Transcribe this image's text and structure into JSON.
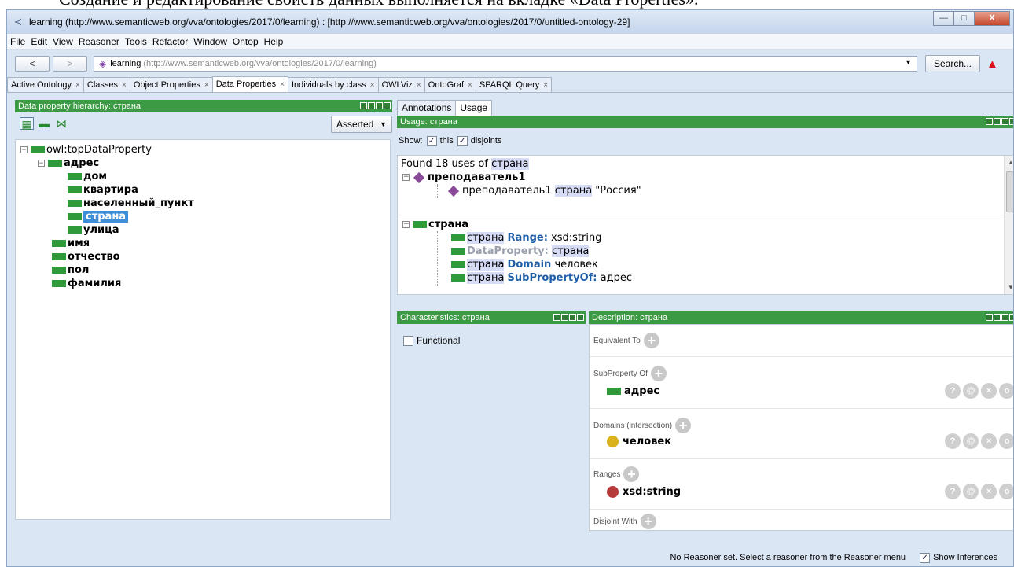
{
  "caption": "Создание и редактирование свойств данных выполняется на вкладке «Data Properties».",
  "window": {
    "title": "learning (http://www.semanticweb.org/vva/ontologies/2017/0/learning) : [http://www.semanticweb.org/vva/ontologies/2017/0/untitled-ontology-29]",
    "controls": {
      "minimize": "—",
      "maximize": "□",
      "close": "X"
    }
  },
  "menu": [
    "File",
    "Edit",
    "View",
    "Reasoner",
    "Tools",
    "Refactor",
    "Window",
    "Ontop",
    "Help"
  ],
  "nav": {
    "back": "<",
    "forward": ">",
    "ontology_name": "learning",
    "ontology_iri": "(http://www.semanticweb.org/vva/ontologies/2017/0/learning)",
    "search_label": "Search..."
  },
  "tabs": [
    {
      "label": "Active Ontology",
      "active": false
    },
    {
      "label": "Classes",
      "active": false
    },
    {
      "label": "Object Properties",
      "active": false
    },
    {
      "label": "Data Properties",
      "active": true
    },
    {
      "label": "Individuals by class",
      "active": false
    },
    {
      "label": "OWLViz",
      "active": false
    },
    {
      "label": "OntoGraf",
      "active": false
    },
    {
      "label": "SPARQL Query",
      "active": false
    }
  ],
  "hierarchy": {
    "header": "Data property hierarchy: страна",
    "mode": "Asserted",
    "tree": [
      {
        "label": "owl:topDataProperty",
        "bold": false
      },
      {
        "label": "адрес",
        "bold": true
      },
      {
        "label": "дом",
        "bold": true
      },
      {
        "label": "квартира",
        "bold": true
      },
      {
        "label": "населенный_пункт",
        "bold": true
      },
      {
        "label": "страна",
        "bold": true
      },
      {
        "label": "улица",
        "bold": true
      },
      {
        "label": "имя",
        "bold": true
      },
      {
        "label": "отчество",
        "bold": true
      },
      {
        "label": "пол",
        "bold": true
      },
      {
        "label": "фамилия",
        "bold": true
      }
    ]
  },
  "right_tabs": [
    "Annotations",
    "Usage"
  ],
  "usage": {
    "header": "Usage: страна",
    "show_label": "Show:",
    "show_this": "this",
    "show_disjoints": "disjoints",
    "found_prefix": "Found 18 uses of",
    "found_term": "страна",
    "group1": {
      "title": "преподаватель1",
      "line_subject": "преподаватель1",
      "line_prop": "страна",
      "line_value": "\"Россия\""
    },
    "group2": {
      "title": "страна",
      "lines": [
        {
          "a": "страна",
          "kw": "Range:",
          "b": "xsd:string"
        },
        {
          "a": "",
          "kw": "DataProperty:",
          "b": "страна"
        },
        {
          "a": "страна",
          "kw": "Domain",
          "b": "человек"
        },
        {
          "a": "страна",
          "kw": "SubPropertyOf:",
          "b": "адрес"
        }
      ]
    }
  },
  "characteristics": {
    "header": "Characteristics: страна",
    "functional_label": "Functional"
  },
  "description": {
    "header": "Description: страна",
    "sections": {
      "equivalent": "Equivalent To",
      "subproperty": "SubProperty Of",
      "domains": "Domains (intersection)",
      "ranges": "Ranges",
      "disjoint": "Disjoint With"
    },
    "subproperty_value": "адрес",
    "domain_value": "человек",
    "range_value": "xsd:string",
    "action_icons": [
      "?",
      "@",
      "×",
      "o"
    ]
  },
  "status": {
    "message": "No Reasoner set. Select a reasoner from the Reasoner menu",
    "show_inferences": "Show Inferences"
  },
  "colors": {
    "panel_header": "#3d9a44",
    "data_property_icon": "#2f9a3a",
    "individual_icon": "#8a4a9a",
    "class_icon": "#d9b21c",
    "datatype_icon": "#b53a3a",
    "selection": "#3f8ed8",
    "keyword": "#1f5fa8"
  }
}
